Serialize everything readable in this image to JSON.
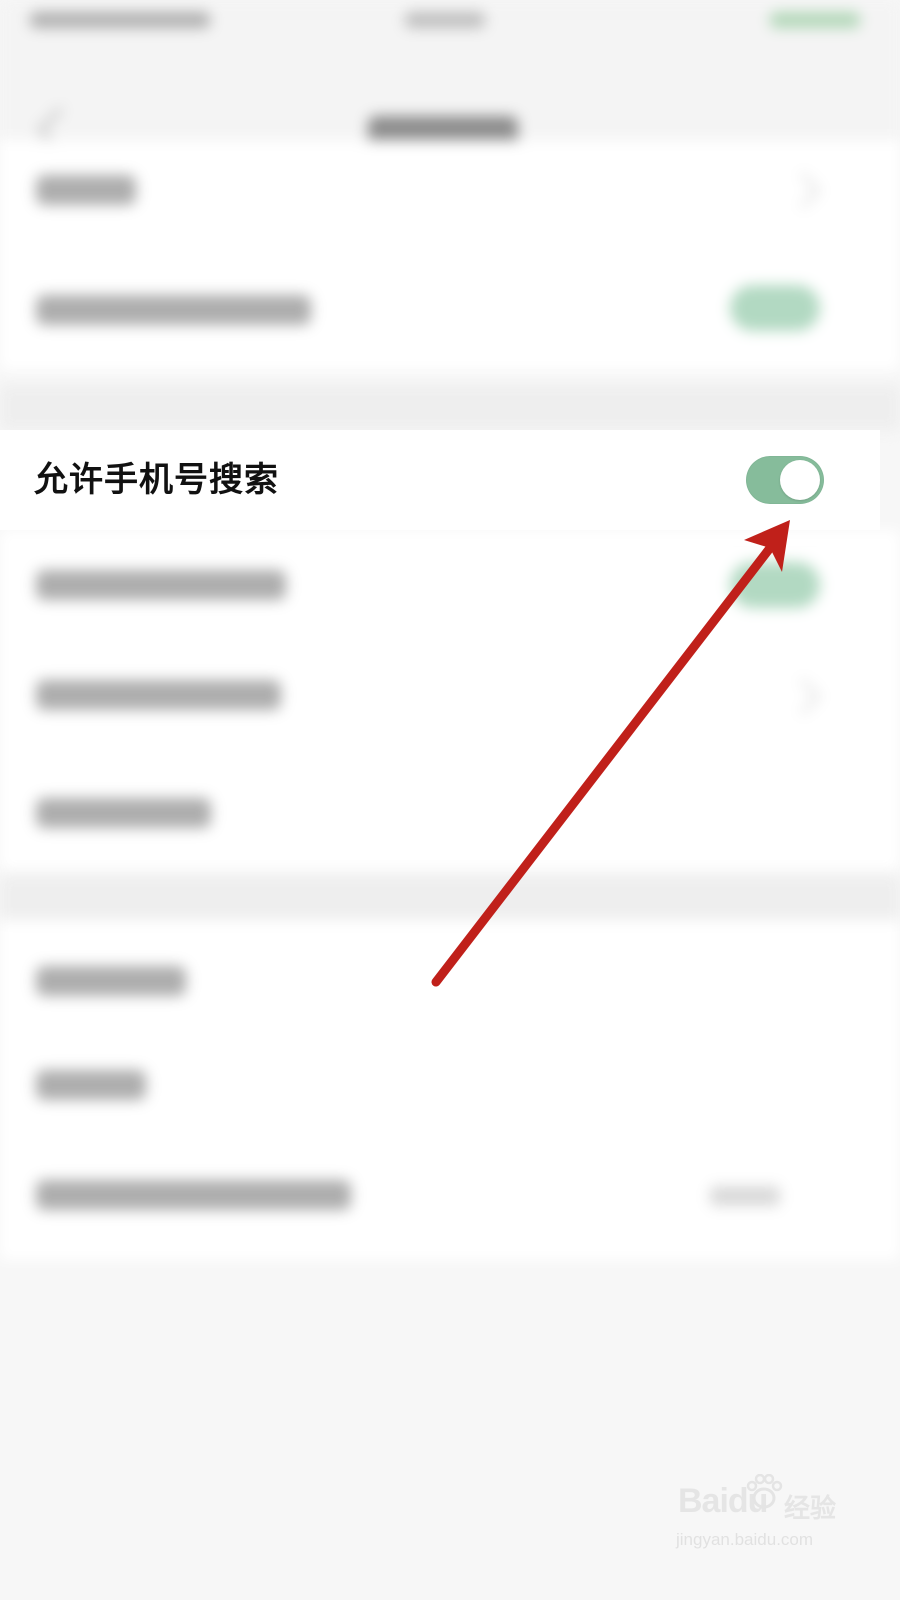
{
  "setting": {
    "label": "允许手机号搜索",
    "toggle_on": true,
    "toggle_color": "#86bc9b"
  },
  "annotation": {
    "arrow_color": "#c0201a"
  },
  "watermark": {
    "brand": "Baidu",
    "brand_cn": "经验",
    "url": "jingyan.baidu.com"
  }
}
